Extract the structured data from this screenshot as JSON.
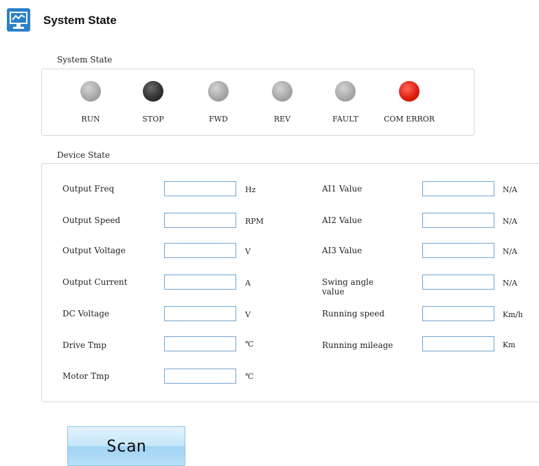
{
  "header": {
    "title": "System State"
  },
  "system_state": {
    "label": "System State",
    "indicators": [
      {
        "label": "RUN",
        "state": "off",
        "color": "#a9a9a9"
      },
      {
        "label": "STOP",
        "state": "active",
        "color": "#333333"
      },
      {
        "label": "FWD",
        "state": "off",
        "color": "#a9a9a9"
      },
      {
        "label": "REV",
        "state": "off",
        "color": "#a9a9a9"
      },
      {
        "label": "FAULT",
        "state": "off",
        "color": "#a9a9a9"
      },
      {
        "label": "COM ERROR",
        "state": "alarm",
        "color": "#e01f10"
      }
    ]
  },
  "device_state": {
    "label": "Device State",
    "left_fields": [
      {
        "label": "Output Freq",
        "value": "",
        "unit": "Hz"
      },
      {
        "label": "Output Speed",
        "value": "",
        "unit": "RPM"
      },
      {
        "label": "Output Voltage",
        "value": "",
        "unit": "V"
      },
      {
        "label": "Output Current",
        "value": "",
        "unit": "A"
      },
      {
        "label": "DC Voltage",
        "value": "",
        "unit": "V"
      },
      {
        "label": "Drive Tmp",
        "value": "",
        "unit": "℃"
      },
      {
        "label": "Motor Tmp",
        "value": "",
        "unit": "℃"
      }
    ],
    "right_fields": [
      {
        "label": "AI1 Value",
        "value": "",
        "unit": "N/A"
      },
      {
        "label": "AI2 Value",
        "value": "",
        "unit": "N/A"
      },
      {
        "label": "AI3 Value",
        "value": "",
        "unit": "N/A"
      },
      {
        "label": "Swing angle value",
        "value": "",
        "unit": "N/A"
      },
      {
        "label": "Running speed",
        "value": "",
        "unit": "Km/h"
      },
      {
        "label": "Running mileage",
        "value": "",
        "unit": "Km"
      }
    ]
  },
  "actions": {
    "scan_label": "Scan"
  }
}
